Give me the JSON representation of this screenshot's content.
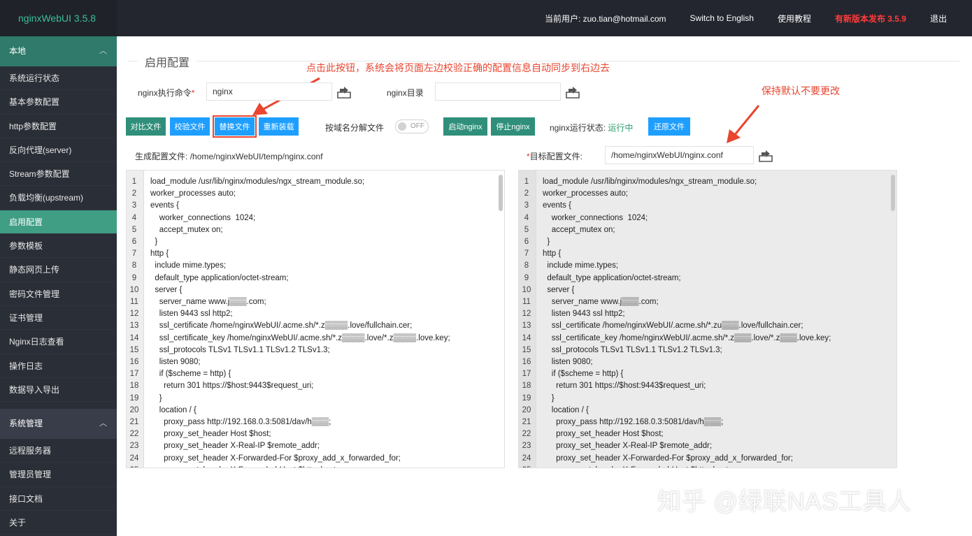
{
  "app": {
    "title": "nginxWebUI 3.5.8"
  },
  "topnav": {
    "current_user": "当前用户: zuo.tian@hotmail.com",
    "switch_lang": "Switch to English",
    "tutorial": "使用教程",
    "update": "有新版本发布 3.5.9",
    "logout": "退出"
  },
  "sidebar": {
    "group1": "本地",
    "items1": [
      "系统运行状态",
      "基本参数配置",
      "http参数配置",
      "反向代理(server)",
      "Stream参数配置",
      "负载均衡(upstream)",
      "启用配置",
      "参数模板",
      "静态网页上传",
      "密码文件管理",
      "证书管理",
      "Nginx日志查看",
      "操作日志",
      "数据导入导出"
    ],
    "group2": "系统管理",
    "items2": [
      "远程服务器",
      "管理员管理",
      "接口文档",
      "关于"
    ]
  },
  "page": {
    "title": "启用配置",
    "annotation_top": "点击此按钮，系统会将页面左边校验正确的配置信息自动同步到右边去",
    "annotation_right": "保持默认不要更改",
    "cmd_label": "nginx执行命令",
    "cmd_required": "*",
    "cmd_value": "nginx",
    "dir_label": "nginx目录",
    "dir_value": "",
    "buttons": {
      "compare": "对比文件",
      "validate": "校验文件",
      "replace": "替换文件",
      "reload": "重新装载",
      "start": "启动nginx",
      "stop": "停止nginx",
      "restore": "还原文件"
    },
    "split_label": "按域名分解文件",
    "split_toggle": "OFF",
    "status_label": "nginx运行状态:",
    "status_value": "运行中",
    "gen_label": "生成配置文件:",
    "gen_path": "/home/nginxWebUI/temp/nginx.conf",
    "target_required": "*",
    "target_label": "目标配置文件:",
    "target_path": "/home/nginxWebUI/nginx.conf"
  },
  "editor_left": [
    "load_module /usr/lib/nginx/modules/ngx_stream_module.so;",
    "worker_processes auto;",
    "events {",
    "    worker_connections  1024;",
    "    accept_mutex on;",
    "  }",
    "http {",
    "  include mime.types;",
    "  default_type application/octet-stream;",
    "  server {",
    "    server_name www.j▒▒▒.com;",
    "    listen 9443 ssl http2;",
    "    ssl_certificate /home/nginxWebUI/.acme.sh/*.z▒▒▒▒.love/fullchain.cer;",
    "    ssl_certificate_key /home/nginxWebUI/.acme.sh/*.z▒▒▒▒.love/*.z▒▒▒▒.love.key;",
    "    ssl_protocols TLSv1 TLSv1.1 TLSv1.2 TLSv1.3;",
    "    listen 9080;",
    "    if ($scheme = http) {",
    "      return 301 https://$host:9443$request_uri;",
    "    }",
    "    location / {",
    "      proxy_pass http://192.168.0.3:5081/dav/h▒▒▒;",
    "      proxy_set_header Host $host;",
    "      proxy_set_header X-Real-IP $remote_addr;",
    "      proxy_set_header X-Forwarded-For $proxy_add_x_forwarded_for;",
    "      proxy_set_header X-Forwarded-Host $http_host;"
  ],
  "editor_right": [
    "load_module /usr/lib/nginx/modules/ngx_stream_module.so;",
    "worker_processes auto;",
    "events {",
    "    worker_connections  1024;",
    "    accept_mutex on;",
    "  }",
    "http {",
    "  include mime.types;",
    "  default_type application/octet-stream;",
    "  server {",
    "    server_name www.j▒▒▒.com;",
    "    listen 9443 ssl http2;",
    "    ssl_certificate /home/nginxWebUI/.acme.sh/*.zu▒▒▒.love/fullchain.cer;",
    "    ssl_certificate_key /home/nginxWebUI/.acme.sh/*.z▒▒▒.love/*.z▒▒▒.love.key;",
    "    ssl_protocols TLSv1 TLSv1.1 TLSv1.2 TLSv1.3;",
    "    listen 9080;",
    "    if ($scheme = http) {",
    "      return 301 https://$host:9443$request_uri;",
    "    }",
    "    location / {",
    "      proxy_pass http://192.168.0.3:5081/dav/h▒▒▒;",
    "      proxy_set_header Host $host;",
    "      proxy_set_header X-Real-IP $remote_addr;",
    "      proxy_set_header X-Forwarded-For $proxy_add_x_forwarded_for;",
    "      proxy_set_header X-Forwarded-Host $http_host;"
  ],
  "watermark": "知乎 @绿联NAS工具人",
  "colors": {
    "accent": "#2f8f7a",
    "blue": "#1e9fff",
    "annotation": "#e9452f",
    "sidebar": "#2a2e36",
    "topbar": "#23262e"
  }
}
